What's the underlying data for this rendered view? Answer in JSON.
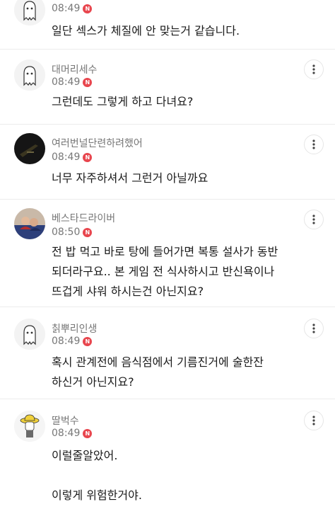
{
  "comments": [
    {
      "nickname": "",
      "time": "08:49",
      "badge": "N",
      "lines": [
        "일단 섹스가 체질에 안 맞는거 같습니다."
      ],
      "avatar": "ghost-avatar-icon"
    },
    {
      "nickname": "대머리세수",
      "time": "08:49",
      "badge": "N",
      "lines": [
        "그런데도 그렇게 하고 다녀요?"
      ],
      "avatar": "ghost-avatar-icon"
    },
    {
      "nickname": "여러번널단련하려했어",
      "time": "08:49",
      "badge": "N",
      "lines": [
        "너무 자주하셔서 그런거 아닐까요"
      ],
      "avatar": "dark-photo-avatar"
    },
    {
      "nickname": "베스타드라이버",
      "time": "08:50",
      "badge": "N",
      "lines": [
        "전 밥 먹고 바로 탕에 들어가면 복통 설사가 동반",
        "되더라구요.. 본 게임 전 식사하시고 반신욕이나",
        "뜨겁게 샤워 하시는건 아닌지요?"
      ],
      "avatar": "photo-avatar"
    },
    {
      "nickname": "칡뿌리인생",
      "time": "08:49",
      "badge": "N",
      "lines": [
        "혹시 관계전에 음식점에서 기름진거에 술한잔",
        "하신거 아닌지요?"
      ],
      "avatar": "ghost-avatar-icon"
    },
    {
      "nickname": "딸벅수",
      "time": "08:49",
      "badge": "N",
      "lines": [
        "이럴줄알았어.",
        "",
        "이렇게 위험한거야."
      ],
      "avatar": "hat-avatar-icon"
    }
  ],
  "colors": {
    "badge": "#e8464e",
    "meta_text": "#777777",
    "body_text": "#1a1a1a",
    "divider": "#ececec"
  },
  "icons": {
    "more": "more-vertical-icon"
  }
}
